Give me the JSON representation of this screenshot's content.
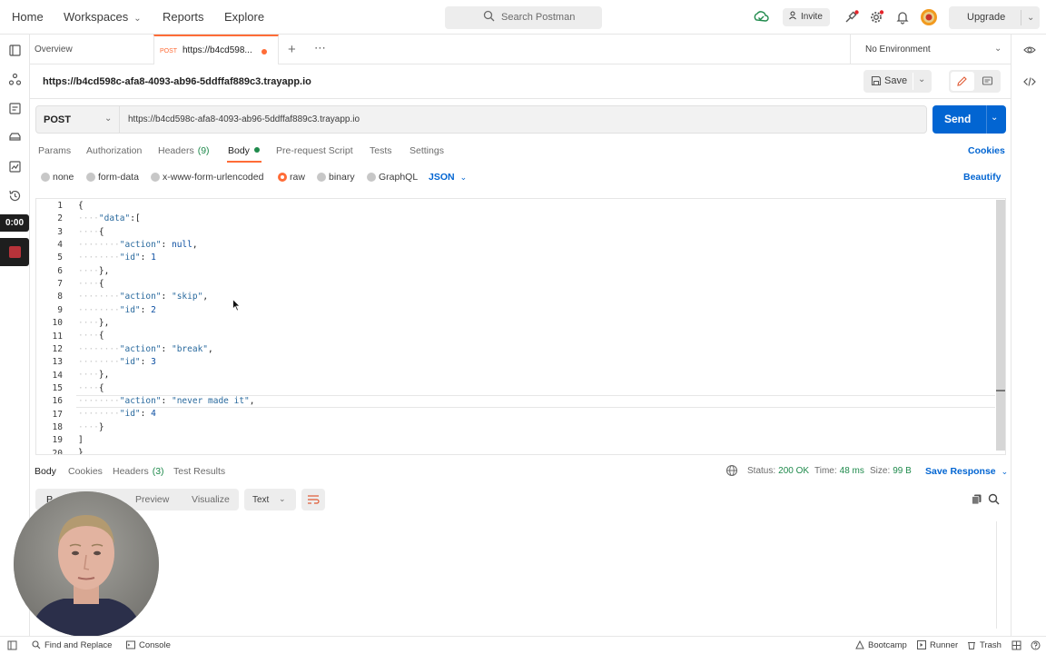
{
  "topbar": {
    "home": "Home",
    "workspaces": "Workspaces",
    "reports": "Reports",
    "explore": "Explore",
    "search_placeholder": "Search Postman",
    "invite": "Invite",
    "upgrade": "Upgrade"
  },
  "tabs": {
    "overview": "Overview",
    "active_method": "POST",
    "active_url": "https://b4cd598...",
    "environment": "No Environment"
  },
  "request": {
    "name": "https://b4cd598c-afa8-4093-ab96-5ddffaf889c3.trayapp.io",
    "save": "Save",
    "method": "POST",
    "url": "https://b4cd598c-afa8-4093-ab96-5ddffaf889c3.trayapp.io",
    "send": "Send",
    "subtabs": {
      "params": "Params",
      "authorization": "Authorization",
      "headers": "Headers",
      "headers_count": "(9)",
      "body": "Body",
      "prerequest": "Pre-request Script",
      "tests": "Tests",
      "settings": "Settings",
      "cookies": "Cookies"
    },
    "body_types": {
      "none": "none",
      "form_data": "form-data",
      "urlencoded": "x-www-form-urlencoded",
      "raw": "raw",
      "binary": "binary",
      "graphql": "GraphQL",
      "format": "JSON",
      "beautify": "Beautify"
    }
  },
  "editor": {
    "line_numbers": [
      "1",
      "2",
      "3",
      "4",
      "5",
      "6",
      "7",
      "8",
      "9",
      "10",
      "11",
      "12",
      "13",
      "14",
      "15",
      "16",
      "17",
      "18",
      "19",
      "20"
    ]
  },
  "response": {
    "tabs": {
      "body": "Body",
      "cookies": "Cookies",
      "headers": "Headers",
      "headers_count": "(3)",
      "test_results": "Test Results"
    },
    "status_label": "Status:",
    "status_value": "200 OK",
    "time_label": "Time:",
    "time_value": "48 ms",
    "size_label": "Size:",
    "size_value": "99 B",
    "save_response": "Save Response",
    "view_pretty": "P",
    "view_preview": "Preview",
    "view_visualize": "Visualize",
    "format": "Text"
  },
  "recorder": {
    "timer": "0:00"
  },
  "statusbar": {
    "find_replace": "Find and Replace",
    "console": "Console",
    "bootcamp": "Bootcamp",
    "runner": "Runner",
    "trash": "Trash"
  },
  "colors": {
    "accent": "#ff6c37",
    "primary": "#0265d2",
    "success": "#1f8a4c"
  }
}
